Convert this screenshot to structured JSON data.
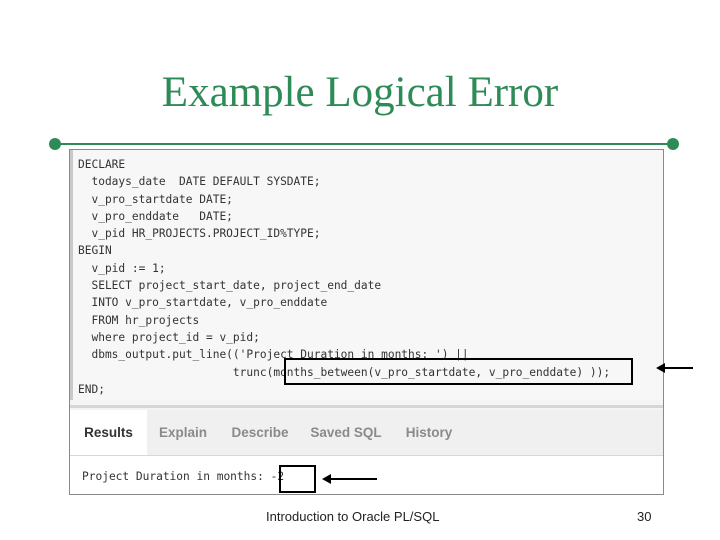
{
  "slide": {
    "title": "Example Logical Error",
    "footer": "Introduction to Oracle PL/SQL",
    "page_number": "30",
    "accent_color": "#2e8b57"
  },
  "editor": {
    "code": "DECLARE\n  todays_date  DATE DEFAULT SYSDATE;\n  v_pro_startdate DATE;\n  v_pro_enddate   DATE;\n  v_pid HR_PROJECTS.PROJECT_ID%TYPE;\nBEGIN\n  v_pid := 1;\n  SELECT project_start_date, project_end_date\n  INTO v_pro_startdate, v_pro_enddate\n  FROM hr_projects\n  where project_id = v_pid;\n  dbms_output.put_line(('Project Duration in months: ') ||\n                       trunc(months_between(v_pro_startdate, v_pro_enddate) ));\nEND;"
  },
  "tabs": [
    {
      "label": "Results",
      "active": true
    },
    {
      "label": "Explain",
      "active": false
    },
    {
      "label": "Describe",
      "active": false
    },
    {
      "label": "Saved SQL",
      "active": false
    },
    {
      "label": "History",
      "active": false
    }
  ],
  "output": {
    "text": "Project Duration in months: -2"
  }
}
